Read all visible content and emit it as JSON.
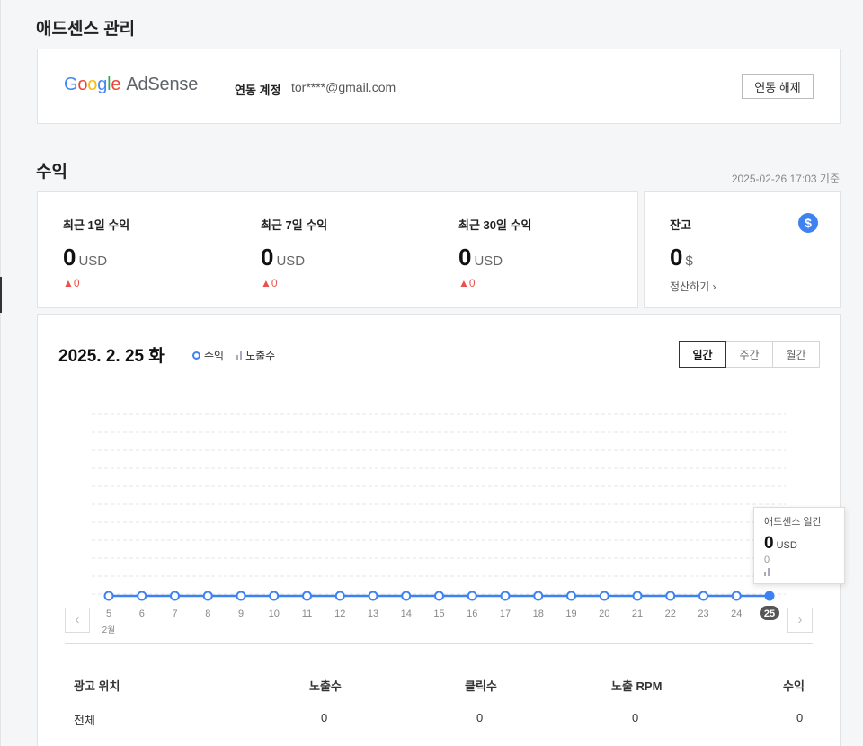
{
  "adsense": {
    "section_title": "애드센스 관리",
    "logo": {
      "google": "Google",
      "product": "AdSense"
    },
    "link_label": "연동 계정",
    "email": "tor****@gmail.com",
    "unlink_button": "연동 해제"
  },
  "revenue": {
    "section_title": "수익",
    "timestamp": "2025-02-26 17:03 기준",
    "stats": [
      {
        "label": "최근 1일 수익",
        "value": "0",
        "unit": "USD",
        "change": "▲0"
      },
      {
        "label": "최근 7일 수익",
        "value": "0",
        "unit": "USD",
        "change": "▲0"
      },
      {
        "label": "최근 30일 수익",
        "value": "0",
        "unit": "USD",
        "change": "▲0"
      }
    ],
    "balance": {
      "label": "잔고",
      "value": "0",
      "unit": "$",
      "settle_link": "정산하기 ›",
      "icon": "$"
    }
  },
  "chart_panel": {
    "date_title": "2025. 2. 25 화",
    "legend": {
      "revenue": "수익",
      "impressions": "노출수"
    },
    "period_tabs": [
      "일간",
      "주간",
      "월간"
    ],
    "active_tab": "일간",
    "month_label": "2월",
    "tooltip": {
      "title": "애드센스 일간",
      "value": "0",
      "unit": "USD",
      "sub": "0"
    },
    "prev_icon": "chevron-left-icon",
    "next_icon": "chevron-right-icon",
    "colors": {
      "line": "#3d82f0",
      "selected_badge": "#555555"
    }
  },
  "chart_data": {
    "type": "line",
    "x": [
      "5",
      "6",
      "7",
      "8",
      "9",
      "10",
      "11",
      "12",
      "13",
      "14",
      "15",
      "16",
      "17",
      "18",
      "19",
      "20",
      "21",
      "22",
      "23",
      "24",
      "25"
    ],
    "series": [
      {
        "name": "수익",
        "values": [
          0,
          0,
          0,
          0,
          0,
          0,
          0,
          0,
          0,
          0,
          0,
          0,
          0,
          0,
          0,
          0,
          0,
          0,
          0,
          0,
          0
        ]
      }
    ],
    "selected_x": "25",
    "grid": true
  },
  "table": {
    "headers": [
      "광고 위치",
      "노출수",
      "클릭수",
      "노출 RPM",
      "수익"
    ],
    "rows": [
      [
        "전체",
        "0",
        "0",
        "0",
        "0"
      ]
    ]
  }
}
